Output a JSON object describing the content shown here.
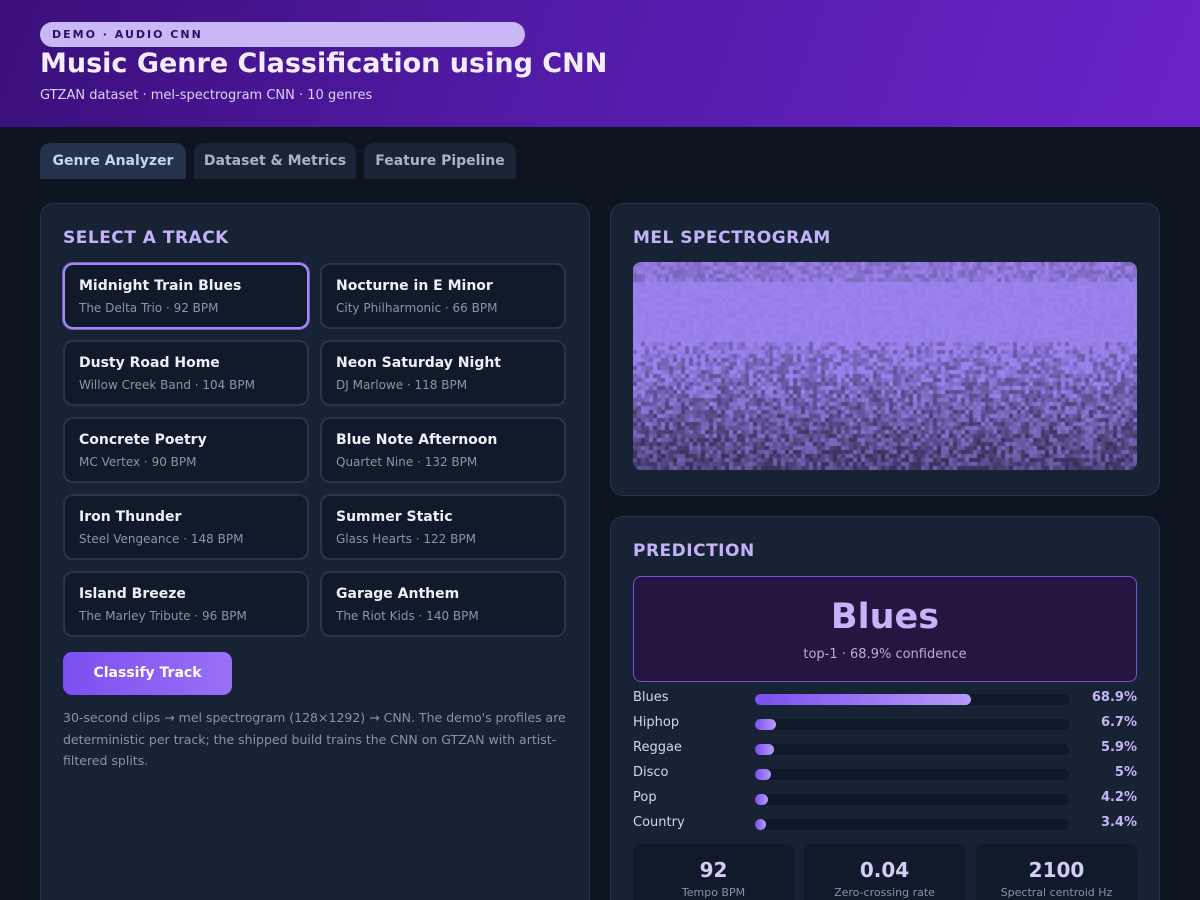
{
  "header": {
    "eyebrow": "DEMO · AUDIO CNN",
    "title": "Music Genre Classification using CNN",
    "subtitle": "GTZAN dataset · mel-spectrogram CNN · 10 genres"
  },
  "tabs": [
    {
      "label": "Genre Analyzer",
      "active": true
    },
    {
      "label": "Dataset & Metrics",
      "active": false
    },
    {
      "label": "Feature Pipeline",
      "active": false
    }
  ],
  "track_panel": {
    "title": "SELECT A TRACK",
    "tracks": [
      {
        "name": "Midnight Train Blues",
        "meta": "The Delta Trio · 92 BPM",
        "selected": true
      },
      {
        "name": "Nocturne in E Minor",
        "meta": "City Philharmonic · 66 BPM",
        "selected": false
      },
      {
        "name": "Dusty Road Home",
        "meta": "Willow Creek Band · 104 BPM",
        "selected": false
      },
      {
        "name": "Neon Saturday Night",
        "meta": "DJ Marlowe · 118 BPM",
        "selected": false
      },
      {
        "name": "Concrete Poetry",
        "meta": "MC Vertex · 90 BPM",
        "selected": false
      },
      {
        "name": "Blue Note Afternoon",
        "meta": "Quartet Nine · 132 BPM",
        "selected": false
      },
      {
        "name": "Iron Thunder",
        "meta": "Steel Vengeance · 148 BPM",
        "selected": false
      },
      {
        "name": "Summer Static",
        "meta": "Glass Hearts · 122 BPM",
        "selected": false
      },
      {
        "name": "Island Breeze",
        "meta": "The Marley Tribute · 96 BPM",
        "selected": false
      },
      {
        "name": "Garage Anthem",
        "meta": "The Riot Kids · 140 BPM",
        "selected": false
      }
    ],
    "classify_label": "Classify Track",
    "note": "30-second clips → mel spectrogram (128×1292) → CNN. The demo's profiles are deterministic per track; the shipped build trains the CNN on GTZAN with artist-filtered splits."
  },
  "spectrogram": {
    "title": "MEL SPECTROGRAM"
  },
  "prediction": {
    "title": "PREDICTION",
    "genre": "Blues",
    "confidence_text": "top-1 · 68.9% confidence",
    "bars": [
      {
        "label": "Blues",
        "value": 68.9,
        "value_text": "68.9%"
      },
      {
        "label": "Hiphop",
        "value": 6.7,
        "value_text": "6.7%"
      },
      {
        "label": "Reggae",
        "value": 5.9,
        "value_text": "5.9%"
      },
      {
        "label": "Disco",
        "value": 5,
        "value_text": "5%"
      },
      {
        "label": "Pop",
        "value": 4.2,
        "value_text": "4.2%"
      },
      {
        "label": "Country",
        "value": 3.4,
        "value_text": "3.4%"
      }
    ],
    "stats": [
      {
        "value": "92",
        "label": "Tempo BPM"
      },
      {
        "value": "0.04",
        "label": "Zero-crossing rate"
      },
      {
        "value": "2100",
        "label": "Spectral centroid Hz"
      }
    ]
  },
  "colors": {
    "accent": "#8b5cf6",
    "background": "#0d1520",
    "panel": "#172235"
  }
}
